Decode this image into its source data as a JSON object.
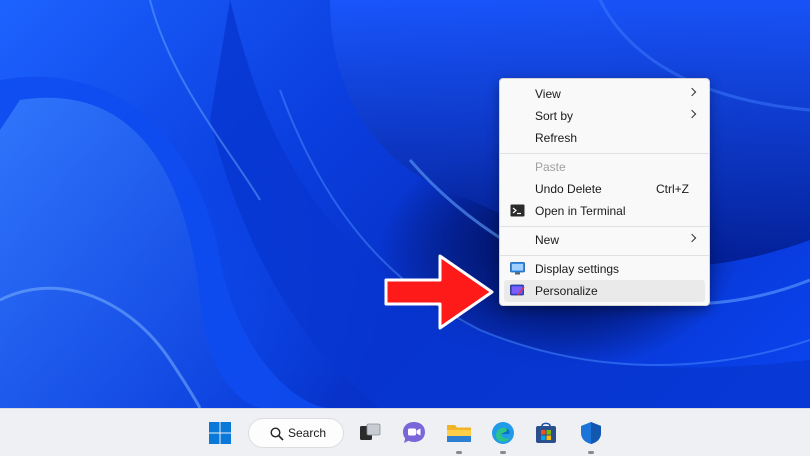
{
  "context_menu": {
    "items": [
      {
        "label": "View",
        "submenu": true
      },
      {
        "label": "Sort by",
        "submenu": true
      },
      {
        "label": "Refresh"
      },
      {
        "label": "Paste",
        "disabled": true
      },
      {
        "label": "Undo Delete",
        "shortcut": "Ctrl+Z"
      },
      {
        "label": "Open in Terminal",
        "icon": "terminal-icon"
      },
      {
        "label": "New",
        "submenu": true
      },
      {
        "label": "Display settings",
        "icon": "display-icon"
      },
      {
        "label": "Personalize",
        "icon": "personalize-icon",
        "highlighted": true
      }
    ]
  },
  "taskbar": {
    "search_label": "Search",
    "icons": [
      "windows-start-icon",
      "search-icon",
      "task-view-icon",
      "teams-chat-icon",
      "file-explorer-icon",
      "edge-icon",
      "store-icon",
      "security-icon"
    ]
  },
  "colors": {
    "accent_arrow": "#ff1a1a",
    "wallpaper": "#0a3fd8",
    "taskbar": "#eef0f4"
  }
}
